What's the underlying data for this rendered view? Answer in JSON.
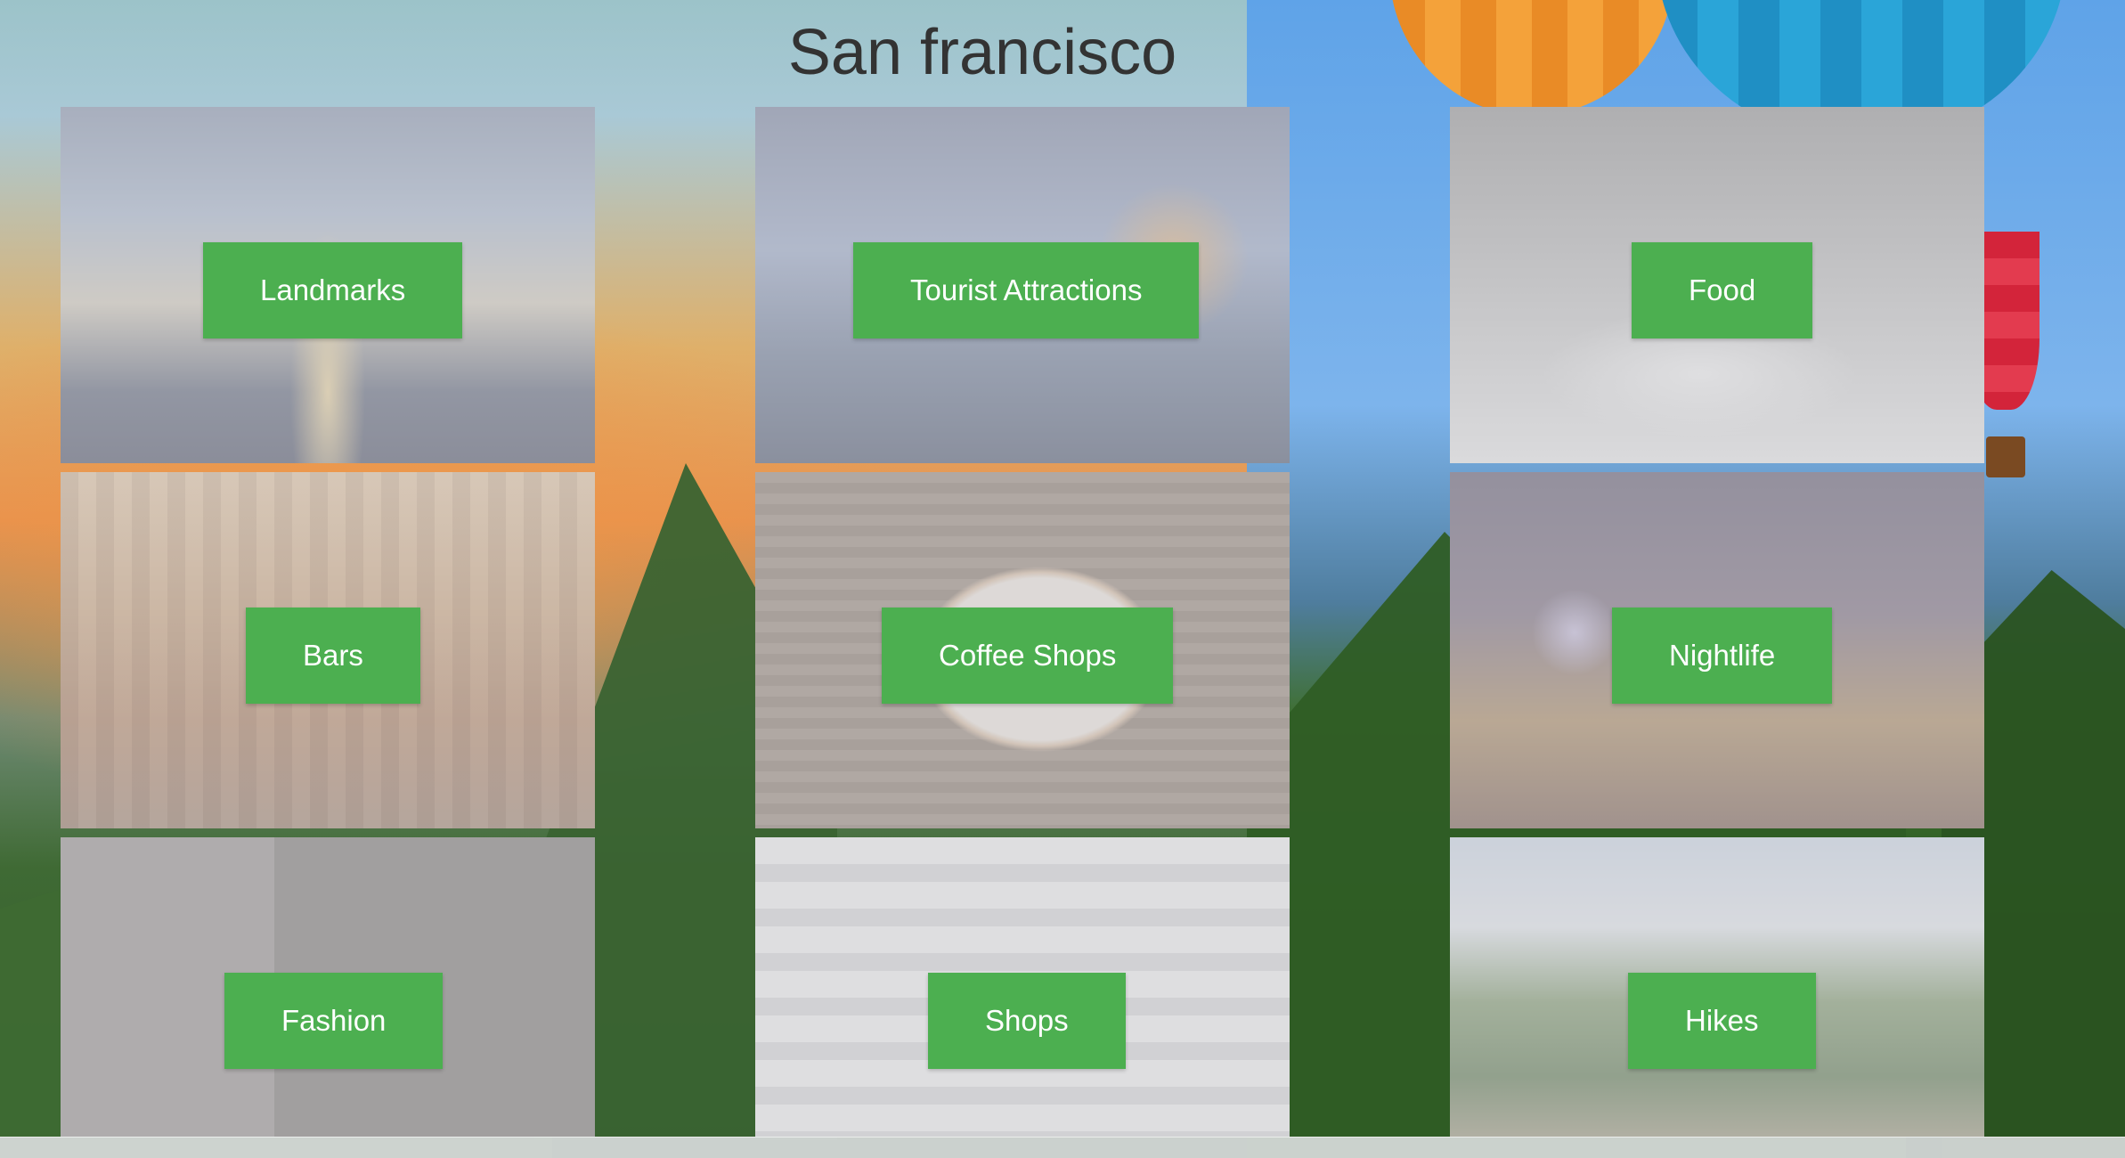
{
  "page": {
    "title": "San francisco"
  },
  "categories": [
    {
      "label": "Landmarks",
      "photo": "eiffel-tower-photo"
    },
    {
      "label": "Tourist Attractions",
      "photo": "ferris-wheel-photo"
    },
    {
      "label": "Food",
      "photo": "plated-dinner-photo"
    },
    {
      "label": "Bars",
      "photo": "bar-interior-photo"
    },
    {
      "label": "Coffee Shops",
      "photo": "latte-art-photo"
    },
    {
      "label": "Nightlife",
      "photo": "cocktail-city-lights-photo"
    },
    {
      "label": "Fashion",
      "photo": "fashion-model-photo"
    },
    {
      "label": "Shops",
      "photo": "shopping-mall-photo"
    },
    {
      "label": "Hikes",
      "photo": "mountain-forest-photo"
    }
  ],
  "colors": {
    "button": "#4caf50",
    "button_text": "#ffffff",
    "title": "#333333"
  }
}
